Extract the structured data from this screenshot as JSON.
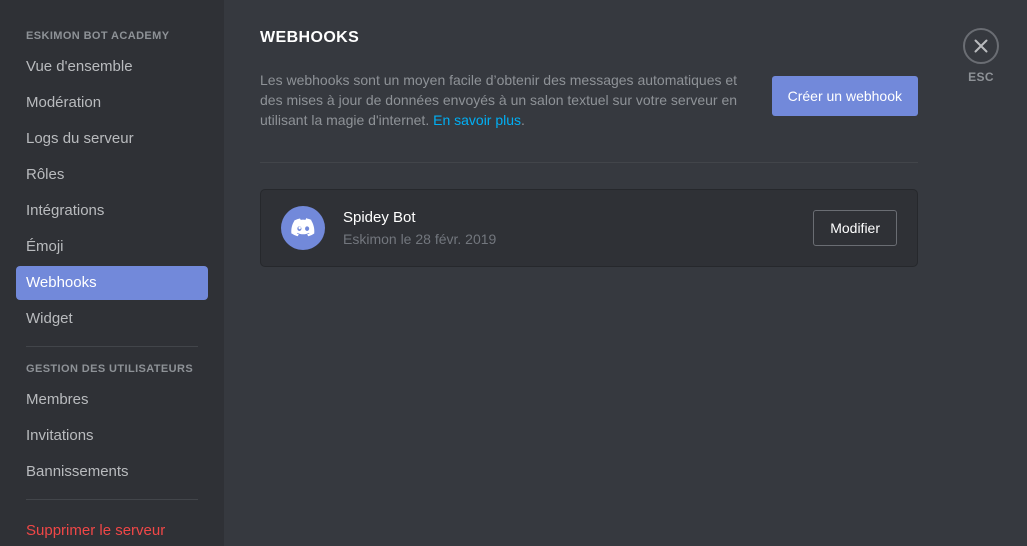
{
  "sidebar": {
    "server_header": "ESKIMON BOT ACADEMY",
    "server_items": [
      {
        "label": "Vue d'ensemble",
        "selected": false
      },
      {
        "label": "Modération",
        "selected": false
      },
      {
        "label": "Logs du serveur",
        "selected": false
      },
      {
        "label": "Rôles",
        "selected": false
      },
      {
        "label": "Intégrations",
        "selected": false
      },
      {
        "label": "Émoji",
        "selected": false
      },
      {
        "label": "Webhooks",
        "selected": true
      },
      {
        "label": "Widget",
        "selected": false
      }
    ],
    "users_header": "GESTION DES UTILISATEURS",
    "users_items": [
      {
        "label": "Membres"
      },
      {
        "label": "Invitations"
      },
      {
        "label": "Bannissements"
      }
    ],
    "danger_item": {
      "label": "Supprimer le serveur"
    }
  },
  "main": {
    "title": "WEBHOOKS",
    "description_part1": "Les webhooks sont un moyen facile d’obtenir des messages automatiques et des mises à jour de données envoyés à un salon textuel sur votre serveur en utilisant la magie d'internet. ",
    "description_link": "En savoir plus",
    "description_part2": ".",
    "create_button": "Créer un webhook"
  },
  "webhooks": [
    {
      "name": "Spidey Bot",
      "meta": "Eskimon le 28 févr. 2019",
      "edit_button": "Modifier",
      "avatar_icon": "discord-clyde-icon"
    }
  ],
  "close": {
    "label": "ESC",
    "icon": "close-icon"
  },
  "colors": {
    "sidebar_bg": "#2f3136",
    "content_bg": "#36393f",
    "accent_blurple": "#7289da",
    "link_blue": "#00aff4",
    "danger_red": "#f04747",
    "muted_text": "#8e9297",
    "card_bg": "#2f3136"
  }
}
